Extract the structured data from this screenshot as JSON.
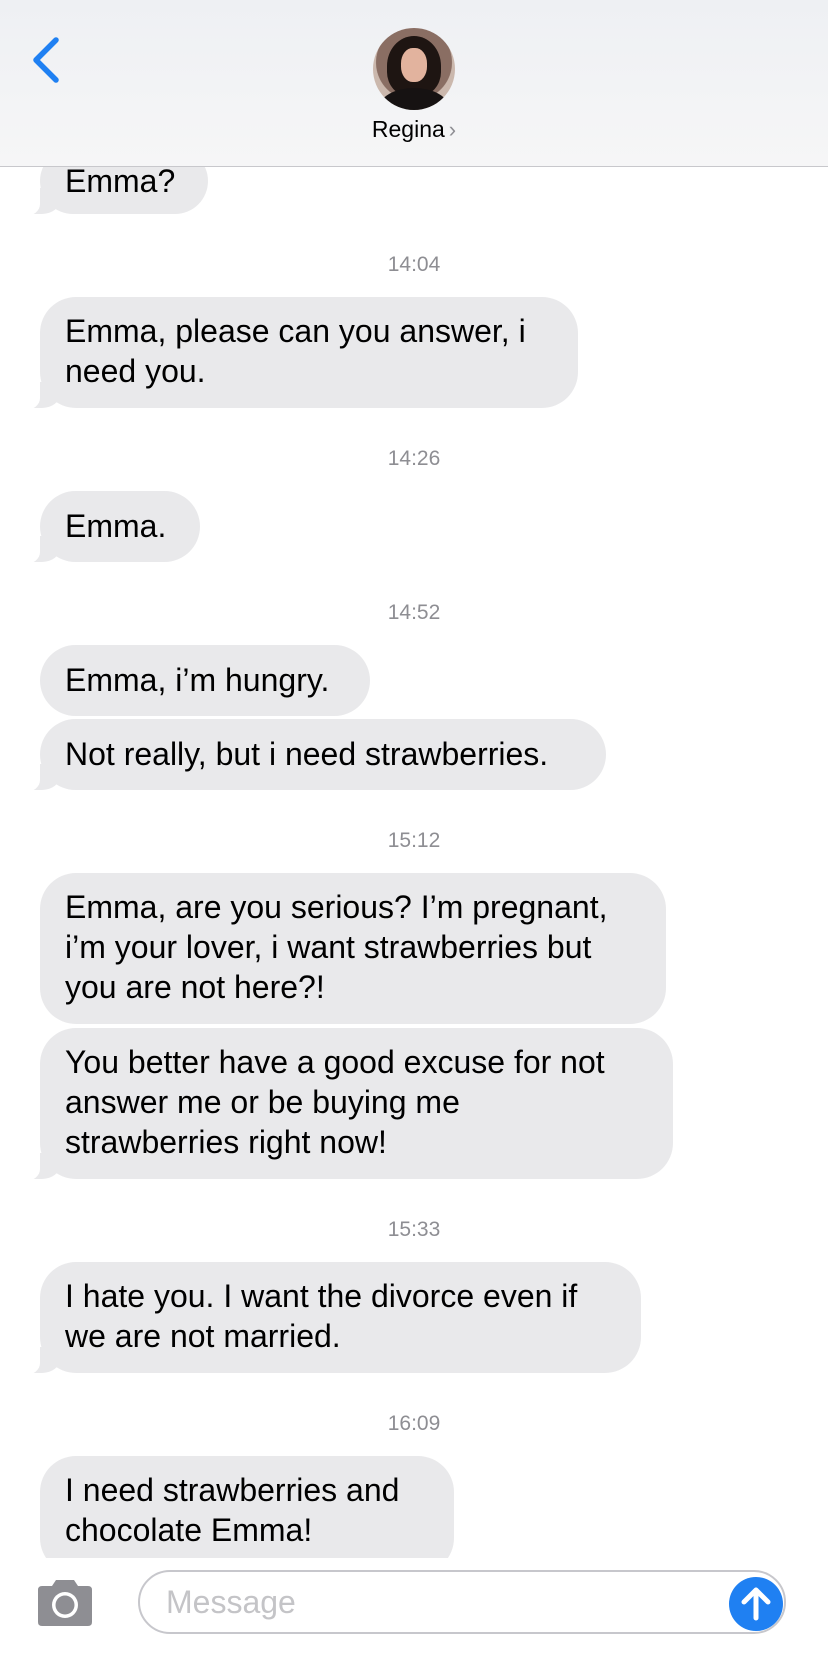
{
  "header": {
    "contact_name": "Regina",
    "chevron": "›",
    "back_icon": "chevron-left-icon",
    "accent_color": "#1f80f2"
  },
  "thread": {
    "messages": [
      {
        "text": "Emma?"
      },
      {
        "time": "14:04"
      },
      {
        "text_lines": [
          "Emma, please can you answer, i",
          "need you."
        ]
      },
      {
        "time": "14:26"
      },
      {
        "text": "Emma."
      },
      {
        "time": "14:52"
      },
      {
        "text": "Emma, i’m hungry."
      },
      {
        "text": "Not really, but i need strawberries."
      },
      {
        "time": "15:12"
      },
      {
        "text_lines": [
          "Emma, are you serious? I’m pregnant,",
          "i’m your lover, i want strawberries but",
          "you are not here?!"
        ]
      },
      {
        "text_lines": [
          "You better have a good excuse for not",
          "answer me or be buying me",
          "strawberries right now!"
        ]
      },
      {
        "time": "15:33"
      },
      {
        "text_lines": [
          "I hate you. I want the divorce even if",
          "we are not married."
        ]
      },
      {
        "time": "16:09"
      },
      {
        "text_lines": [
          "I need strawberries and",
          "chocolate Emma!"
        ]
      }
    ]
  },
  "composer": {
    "placeholder": "Message",
    "camera_icon": "camera-icon",
    "send_icon": "arrow-up-icon"
  }
}
